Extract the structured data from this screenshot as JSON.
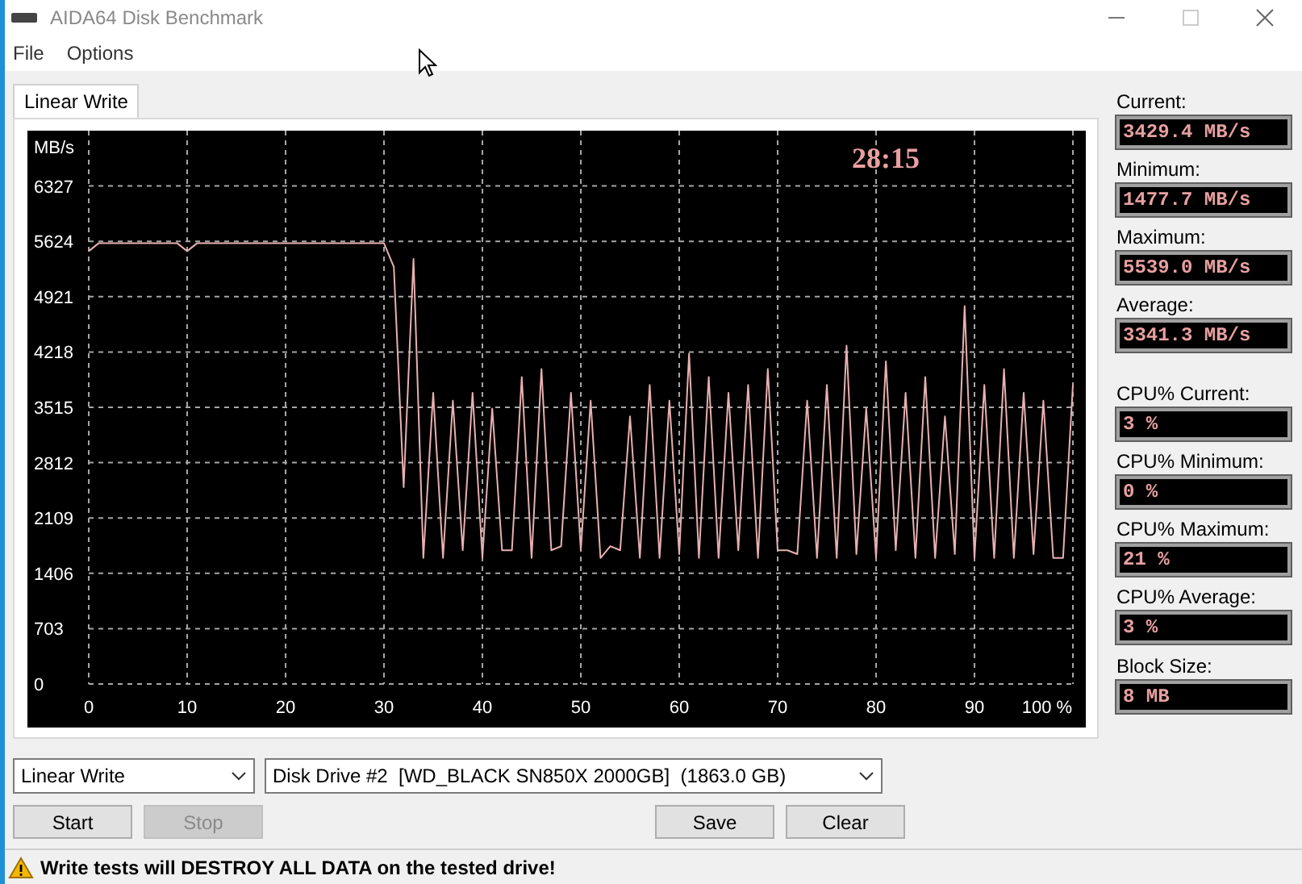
{
  "window": {
    "title": "AIDA64 Disk Benchmark"
  },
  "menu": [
    "File",
    "Options"
  ],
  "tabs": [
    {
      "label": "Linear Write",
      "selected": true
    }
  ],
  "chart": {
    "timer": "28:15",
    "chart_data": {
      "type": "line",
      "ylabel": "MB/s",
      "xlim": [
        0,
        100
      ],
      "ylim": [
        0,
        7030
      ],
      "grid": true,
      "x": [
        0,
        1,
        2,
        3,
        4,
        5,
        6,
        7,
        8,
        9,
        10,
        11,
        12,
        13,
        14,
        15,
        16,
        17,
        18,
        19,
        20,
        21,
        22,
        23,
        24,
        25,
        26,
        27,
        28,
        29,
        30,
        31,
        32,
        33,
        34,
        35,
        36,
        37,
        38,
        39,
        40,
        41,
        42,
        43,
        44,
        45,
        46,
        47,
        48,
        49,
        50,
        51,
        52,
        53,
        54,
        55,
        56,
        57,
        58,
        59,
        60,
        61,
        62,
        63,
        64,
        65,
        66,
        67,
        68,
        69,
        70,
        71,
        72,
        73,
        74,
        75,
        76,
        77,
        78,
        79,
        80,
        81,
        82,
        83,
        84,
        85,
        86,
        87,
        88,
        89,
        90,
        91,
        92,
        93,
        94,
        95,
        96,
        97,
        98,
        99,
        100
      ],
      "yticks": [
        0,
        703,
        1406,
        2109,
        2812,
        3515,
        4218,
        4921,
        5624,
        6327
      ],
      "xticks": [
        0,
        10,
        20,
        30,
        40,
        50,
        60,
        70,
        80,
        90,
        {
          "value": 100,
          "label": "100 %"
        }
      ],
      "series": [
        {
          "color": "#e8b0b0",
          "values": [
            5500,
            5600,
            5600,
            5600,
            5600,
            5600,
            5600,
            5600,
            5600,
            5600,
            5500,
            5600,
            5600,
            5600,
            5600,
            5600,
            5600,
            5600,
            5600,
            5600,
            5600,
            5600,
            5600,
            5600,
            5600,
            5600,
            5600,
            5600,
            5600,
            5600,
            5600,
            5300,
            2500,
            5400,
            1600,
            3700,
            1600,
            3600,
            1700,
            3700,
            1600,
            3500,
            1700,
            1700,
            3900,
            1600,
            4000,
            1700,
            1750,
            3700,
            1700,
            3600,
            1600,
            1750,
            1700,
            3400,
            1600,
            3800,
            1600,
            3600,
            1650,
            4200,
            1600,
            3900,
            1600,
            3700,
            1700,
            3800,
            1600,
            4000,
            1700,
            1700,
            1650,
            3600,
            1600,
            3800,
            1600,
            4300,
            1650,
            3500,
            1600,
            4100,
            1700,
            3700,
            1600,
            3900,
            1600,
            3400,
            1650,
            4800,
            1600,
            3800,
            1600,
            4000,
            1600,
            3700,
            1650,
            3600,
            1600,
            1600,
            3800
          ]
        }
      ]
    }
  },
  "disk_stats": [
    {
      "label": "Current:",
      "value": "3429.4 MB/s"
    },
    {
      "label": "Minimum:",
      "value": "1477.7 MB/s"
    },
    {
      "label": "Maximum:",
      "value": "5539.0 MB/s"
    },
    {
      "label": "Average:",
      "value": "3341.3 MB/s"
    }
  ],
  "cpu_stats": [
    {
      "label": "CPU% Current:",
      "value": "3 %"
    },
    {
      "label": "CPU% Minimum:",
      "value": "0 %"
    },
    {
      "label": "CPU% Maximum:",
      "value": "21 %"
    },
    {
      "label": "CPU% Average:",
      "value": "3 %"
    }
  ],
  "block_size": {
    "label": "Block Size:",
    "value": "8 MB"
  },
  "test_select": {
    "value": "Linear Write"
  },
  "drive_select": {
    "value": "Disk Drive #2  [WD_BLACK SN850X 2000GB]  (1863.0 GB)"
  },
  "buttons": [
    {
      "label": "Start",
      "disabled": false
    },
    {
      "label": "Stop",
      "disabled": true
    },
    {
      "label": "Save",
      "disabled": false
    },
    {
      "label": "Clear",
      "disabled": false
    }
  ],
  "status_bar": {
    "warning": "Write tests will DESTROY ALL DATA on the tested drive!"
  }
}
